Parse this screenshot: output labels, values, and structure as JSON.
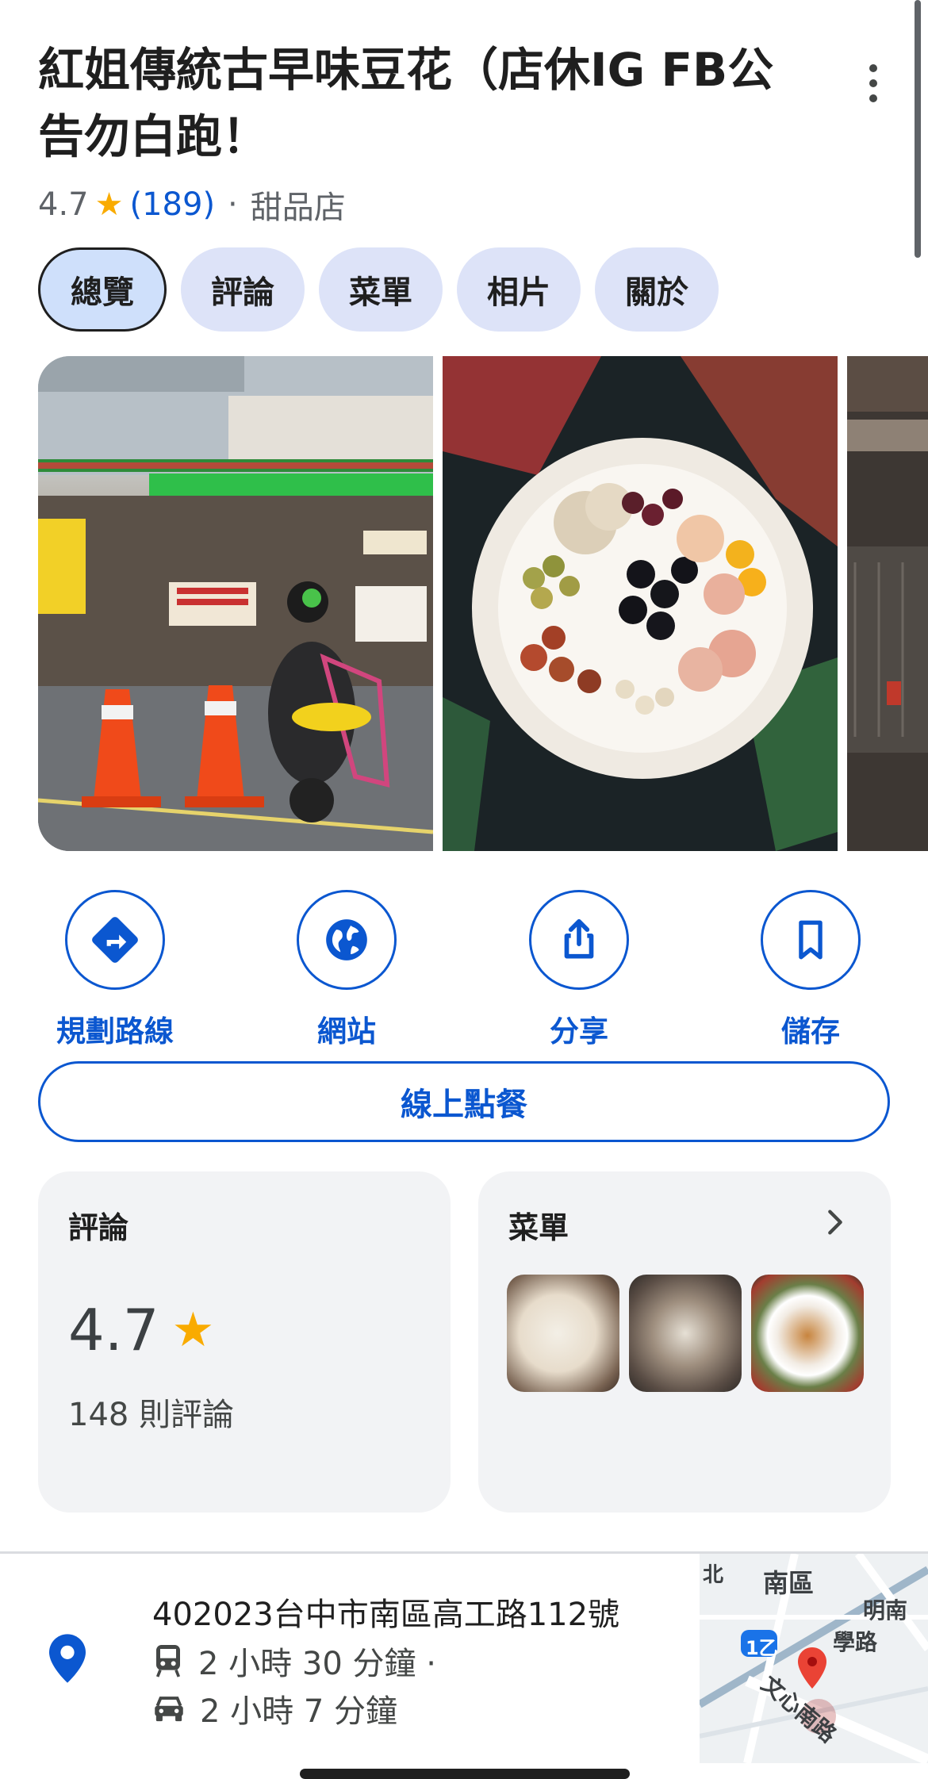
{
  "place": {
    "title": "紅姐傳統古早味豆花（店休IG FB公告勿白跑！",
    "rating": "4.7",
    "review_count": "(189)",
    "separator": "·",
    "category": "甜品店"
  },
  "tabs": [
    {
      "label": "總覽",
      "active": true
    },
    {
      "label": "評論",
      "active": false
    },
    {
      "label": "菜單",
      "active": false
    },
    {
      "label": "相片",
      "active": false
    },
    {
      "label": "關於",
      "active": false
    }
  ],
  "actions": [
    {
      "label": "規劃路線",
      "icon": "directions-icon"
    },
    {
      "label": "網站",
      "icon": "globe-icon"
    },
    {
      "label": "分享",
      "icon": "share-icon"
    },
    {
      "label": "儲存",
      "icon": "bookmark-icon"
    }
  ],
  "order_button": "線上點餐",
  "reviews_card": {
    "title": "評論",
    "rating": "4.7",
    "count_text": "148 則評論"
  },
  "menu_card": {
    "title": "菜單"
  },
  "location": {
    "address": "402023台中市南區高工路112號",
    "transit_time": "2 小時 30 分鐘 ·",
    "drive_time": "2 小時 7 分鐘"
  },
  "map": {
    "labels": [
      "南區",
      "明南",
      "學路",
      "文心南路",
      "北"
    ],
    "route_badge": "1乙"
  },
  "colors": {
    "accent": "#0b57d0",
    "star": "#f9ab00",
    "chip_bg": "#dde3f8",
    "map_pin": "#ea4335"
  }
}
